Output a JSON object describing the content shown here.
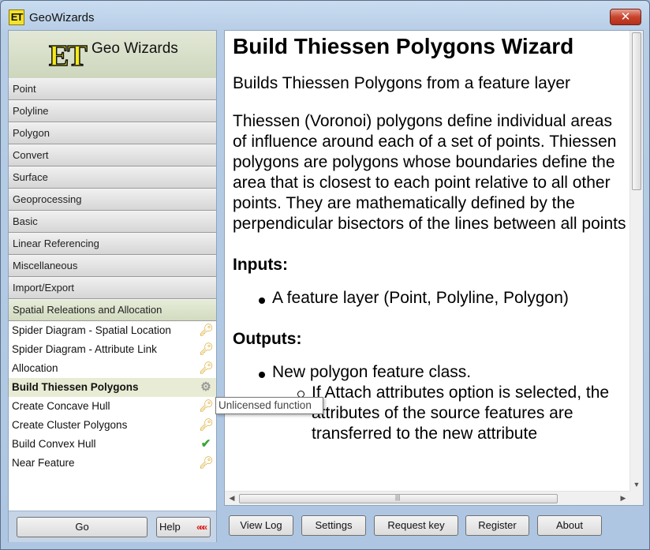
{
  "window": {
    "title": "GeoWizards",
    "icon_text": "ET",
    "close_glyph": "✕"
  },
  "sidebar": {
    "logo_mark": "ET",
    "logo_text": "Geo Wizards",
    "categories": [
      {
        "label": "Point"
      },
      {
        "label": "Polyline"
      },
      {
        "label": "Polygon"
      },
      {
        "label": "Convert"
      },
      {
        "label": "Surface"
      },
      {
        "label": "Geoprocessing"
      },
      {
        "label": "Basic"
      },
      {
        "label": "Linear Referencing"
      },
      {
        "label": "Miscellaneous"
      },
      {
        "label": "Import/Export"
      },
      {
        "label": "Spatial Releations and Allocation"
      }
    ],
    "functions": [
      {
        "label": "Spider Diagram - Spatial Location",
        "icon": "key-icon"
      },
      {
        "label": "Spider Diagram - Attribute Link",
        "icon": "key-icon"
      },
      {
        "label": "Allocation",
        "icon": "key-icon"
      },
      {
        "label": "Build Thiessen Polygons",
        "icon": "lock-gear-icon"
      },
      {
        "label": "Create Concave Hull",
        "icon": "key-icon"
      },
      {
        "label": "Create Cluster Polygons",
        "icon": "key-icon"
      },
      {
        "label": "Build Convex Hull",
        "icon": "check-icon"
      },
      {
        "label": "Near Feature",
        "icon": "key-icon"
      }
    ],
    "go_label": "Go",
    "help_label": "Help",
    "help_arrows": "«««"
  },
  "content": {
    "title": "Build Thiessen Polygons Wizard",
    "lead": "Builds Thiessen Polygons from a feature layer",
    "description": "Thiessen (Voronoi) polygons define individual areas of influence around each of a set of points. Thiessen polygons are polygons whose boundaries define the area that is closest to each point relative to all other points. They are mathematically defined by the perpendicular bisectors of the lines between all points",
    "inputs_heading": "Inputs:",
    "inputs_item": "A  feature layer  (Point, Polyline, Polygon)",
    "outputs_heading": "Outputs:",
    "outputs_item": "New polygon  feature class.",
    "outputs_sub_item": "If  Attach attributes option is selected, the attributes of the source features are transferred to the new attribute"
  },
  "tooltip": "Unlicensed function",
  "toolbar": {
    "view_log": "View Log",
    "settings": "Settings",
    "request_key": "Request key",
    "register": "Register",
    "about": "About"
  }
}
